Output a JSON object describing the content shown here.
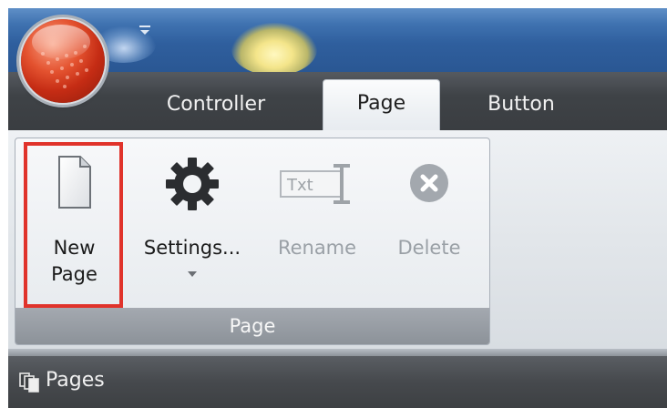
{
  "tabs": [
    {
      "label": "Controller",
      "selected": false
    },
    {
      "label": "Page",
      "selected": true
    },
    {
      "label": "Button",
      "selected": false
    }
  ],
  "ribbon": {
    "group": {
      "caption": "Page",
      "buttons": [
        {
          "lines": [
            "New",
            "Page"
          ],
          "icon": "new-page-icon",
          "enabled": true,
          "highlighted": true
        },
        {
          "lines": [
            "Settings..."
          ],
          "icon": "gear-icon",
          "enabled": true,
          "has_dropdown": true
        },
        {
          "lines": [
            "Rename"
          ],
          "icon": "rename-text-icon",
          "icon_text": "Txt",
          "enabled": false
        },
        {
          "lines": [
            "Delete"
          ],
          "icon": "delete-icon",
          "enabled": false
        }
      ]
    }
  },
  "pane": {
    "title": "Pages",
    "icon": "pages-icon"
  },
  "colors": {
    "highlight_border": "#e0332b",
    "title_bar": "#3f72b0",
    "orb": "#c52c14",
    "disabled_text": "#9aa0a6"
  }
}
